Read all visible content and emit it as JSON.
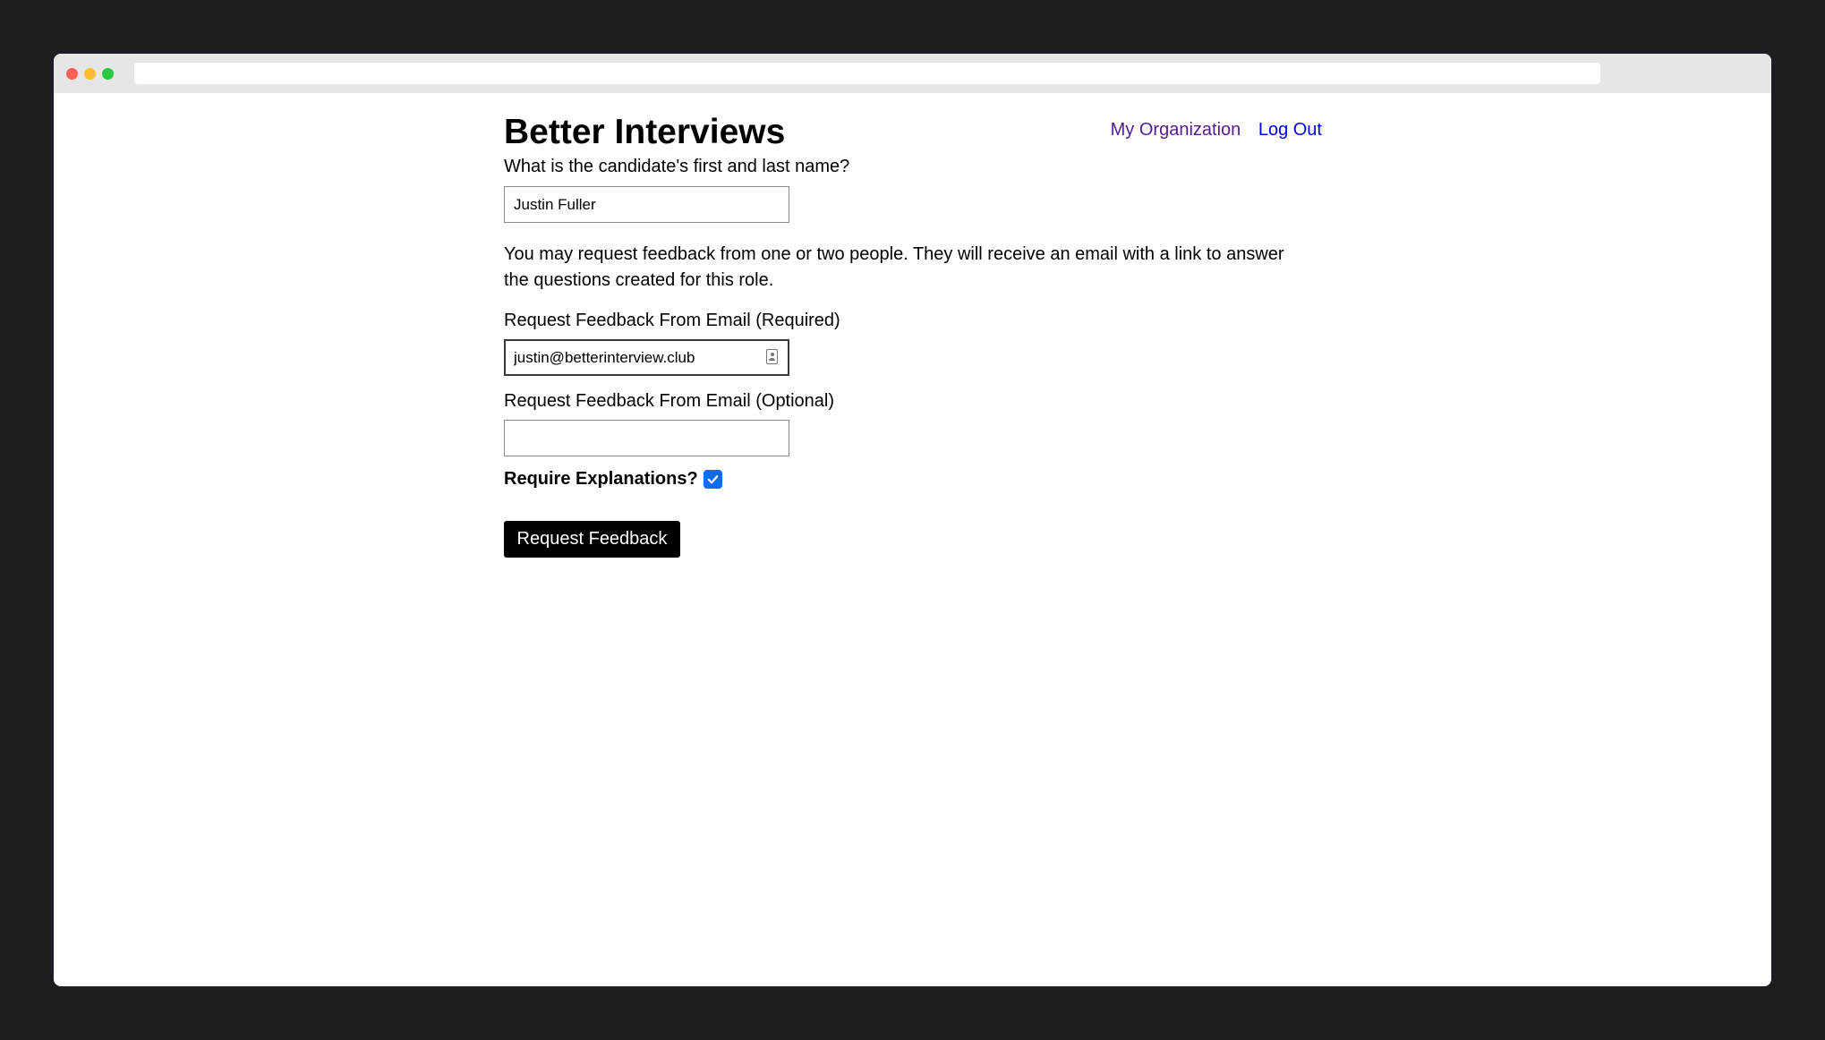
{
  "app": {
    "title": "Better Interviews"
  },
  "nav": {
    "my_organization": "My Organization",
    "log_out": "Log Out"
  },
  "form": {
    "candidate_name_label": "What is the candidate's first and last name?",
    "candidate_name_value": "Justin Fuller",
    "info_text": "You may request feedback from one or two people. They will receive an email with a link to answer the questions created for this role.",
    "email_required_label": "Request Feedback From Email (Required)",
    "email_required_value": "justin@betterinterview.club",
    "email_optional_label": "Request Feedback From Email (Optional)",
    "email_optional_value": "",
    "require_explanations_label": "Require Explanations?",
    "require_explanations_checked": true,
    "submit_label": "Request Feedback"
  },
  "colors": {
    "visited_link": "#551a8b",
    "link": "#0000ee",
    "checkbox_accent": "#0b6cf0",
    "button_bg": "#000000"
  }
}
